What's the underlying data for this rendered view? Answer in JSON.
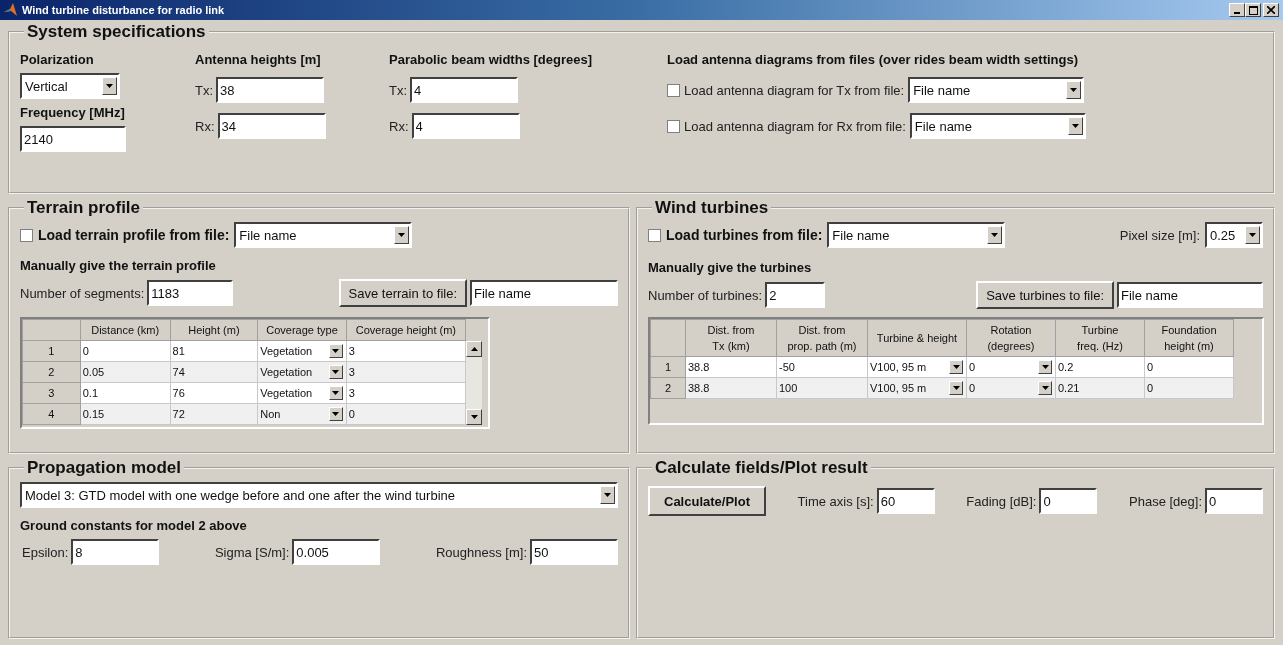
{
  "window": {
    "title": "Wind turbine disturbance for radio link"
  },
  "system_specifications": {
    "title": "System specifications",
    "polarization": {
      "label": "Polarization",
      "value": "Vertical"
    },
    "frequency": {
      "label": "Frequency [MHz]",
      "value": "2140"
    },
    "antenna_heights": {
      "label": "Antenna heights [m]",
      "fields": [
        {
          "label": "Tx:",
          "value": "38"
        },
        {
          "label": "Rx:",
          "value": "34"
        }
      ]
    },
    "beam_widths": {
      "label": "Parabolic beam widths [degrees]",
      "fields": [
        {
          "label": "Tx:",
          "value": "4"
        },
        {
          "label": "Rx:",
          "value": "4"
        }
      ]
    },
    "antenna_diagrams": {
      "label": "Load antenna diagrams from files (over rides beam width settings)",
      "rows": [
        {
          "label": "Load antenna diagram for Tx from file:",
          "checked": false,
          "value": "File name"
        },
        {
          "label": "Load antenna diagram for Rx from file:",
          "checked": false,
          "value": "File name"
        }
      ]
    }
  },
  "terrain_profile": {
    "title": "Terrain profile",
    "load": {
      "label": "Load terrain profile from file:",
      "checked": false,
      "value": "File name"
    },
    "manual_label": "Manually give the terrain profile",
    "count": {
      "label": "Number of segments:",
      "value": "1183"
    },
    "save_button": "Save terrain to file:",
    "save_file": "File name",
    "table": {
      "columns": [
        {
          "label": "Distance (km)",
          "kind": "text"
        },
        {
          "label": "Height (m)",
          "kind": "text"
        },
        {
          "label": "Coverage type",
          "kind": "dropdown"
        },
        {
          "label": "Coverage height (m)",
          "kind": "text"
        }
      ],
      "rows": [
        {
          "index": "1",
          "cells": [
            "0",
            "81",
            "Vegetation",
            "3"
          ]
        },
        {
          "index": "2",
          "cells": [
            "0.05",
            "74",
            "Vegetation",
            "3"
          ]
        },
        {
          "index": "3",
          "cells": [
            "0.1",
            "76",
            "Vegetation",
            "3"
          ]
        },
        {
          "index": "4",
          "cells": [
            "0.15",
            "72",
            "Non",
            "0"
          ]
        }
      ]
    }
  },
  "wind_turbines": {
    "title": "Wind turbines",
    "load": {
      "label": "Load turbines from file:",
      "checked": false,
      "value": "File name"
    },
    "pixel_size": {
      "label": "Pixel size [m]:",
      "value": "0.25"
    },
    "manual_label": "Manually give the turbines",
    "count": {
      "label": "Number of turbines:",
      "value": "2"
    },
    "save_button": "Save turbines to file:",
    "save_file": "File name",
    "table": {
      "columns": [
        {
          "label": "Dist. from\nTx (km)",
          "kind": "text"
        },
        {
          "label": "Dist. from\nprop. path (m)",
          "kind": "text"
        },
        {
          "label": "Turbine & height",
          "kind": "dropdown"
        },
        {
          "label": "Rotation\n(degrees)",
          "kind": "dropdown"
        },
        {
          "label": "Turbine\nfreq. (Hz)",
          "kind": "text"
        },
        {
          "label": "Foundation\nheight (m)",
          "kind": "text"
        }
      ],
      "rows": [
        {
          "index": "1",
          "cells": [
            "38.8",
            "-50",
            "V100, 95 m",
            "0",
            "0.2",
            "0"
          ]
        },
        {
          "index": "2",
          "cells": [
            "38.8",
            "100",
            "V100, 95 m",
            "0",
            "0.21",
            "0"
          ]
        }
      ]
    }
  },
  "propagation_model": {
    "title": "Propagation model",
    "model": "Model 3: GTD model with one wedge before and one after the wind turbine",
    "ground_label": "Ground constants for model 2 above",
    "fields": [
      {
        "label": "Epsilon:",
        "value": "8"
      },
      {
        "label": "Sigma [S/m]:",
        "value": "0.005"
      },
      {
        "label": "Roughness [m]:",
        "value": "50"
      }
    ]
  },
  "calculate": {
    "title": "Calculate fields/Plot result",
    "button": "Calculate/Plot",
    "fields": [
      {
        "label": "Time axis [s]:",
        "value": "60"
      },
      {
        "label": "Fading [dB]:",
        "value": "0"
      },
      {
        "label": "Phase [deg]:",
        "value": "0"
      }
    ]
  }
}
